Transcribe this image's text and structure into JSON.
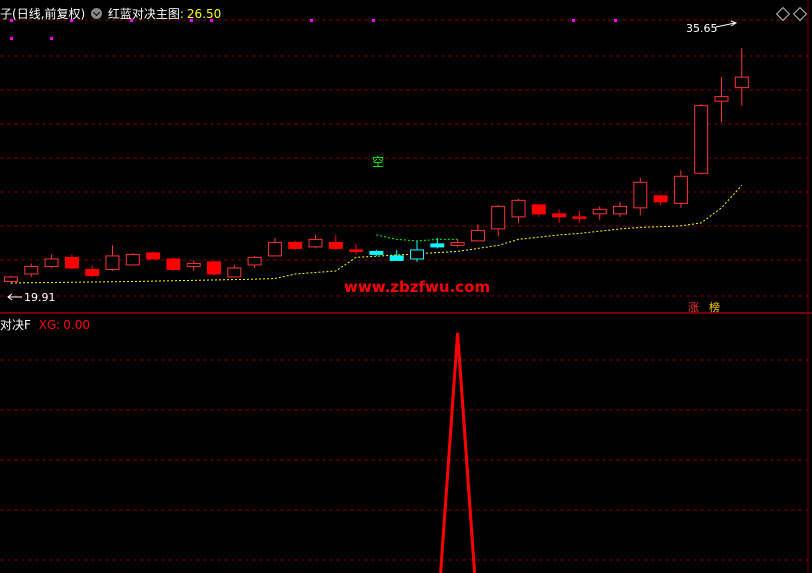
{
  "header": {
    "stock_name": "子",
    "period_label": "(日线,前复权)",
    "indicator_name": "红蓝对决主图",
    "indicator_sep": ":",
    "indicator_value": "26.50"
  },
  "sub_panel": {
    "indicator_name": "对决F",
    "series_label": "XG:",
    "series_value": "0.00"
  },
  "labels": {
    "high_price": "35.65",
    "low_price": "19.91",
    "kong_marker": "空",
    "watermark": "www.zbzfwu.com",
    "badge_zhang": "涨",
    "badge_bang": "榜"
  },
  "colors": {
    "up": "#ff3232",
    "down": "#ff0000",
    "cyan": "#00ffff",
    "line_yellow": "#ffff00",
    "line_green": "#00ff00",
    "grid": "#7a0000",
    "text_white": "#ffffff",
    "text_yellow": "#ffff00",
    "text_red": "#ff0000",
    "text_magenta": "#ff00ff"
  },
  "chart_data": [
    {
      "type": "candlestick",
      "title": "红蓝对决主图",
      "ylim": [
        19.0,
        37.5
      ],
      "y_high_label": 35.65,
      "y_low_label": 19.91,
      "candles": [
        {
          "o": 20.1,
          "h": 20.5,
          "l": 19.91,
          "c": 20.4,
          "k": "up"
        },
        {
          "o": 20.6,
          "h": 21.3,
          "l": 20.4,
          "c": 21.1,
          "k": "up"
        },
        {
          "o": 21.1,
          "h": 21.9,
          "l": 21.0,
          "c": 21.6,
          "k": "up"
        },
        {
          "o": 21.7,
          "h": 21.9,
          "l": 20.9,
          "c": 21.0,
          "k": "down"
        },
        {
          "o": 20.9,
          "h": 21.2,
          "l": 20.4,
          "c": 20.5,
          "k": "down"
        },
        {
          "o": 20.9,
          "h": 22.5,
          "l": 20.8,
          "c": 21.8,
          "k": "up"
        },
        {
          "o": 21.2,
          "h": 22.0,
          "l": 21.2,
          "c": 21.9,
          "k": "up"
        },
        {
          "o": 22.0,
          "h": 22.1,
          "l": 21.6,
          "c": 21.6,
          "k": "down"
        },
        {
          "o": 21.6,
          "h": 21.7,
          "l": 20.8,
          "c": 20.9,
          "k": "down"
        },
        {
          "o": 21.1,
          "h": 21.5,
          "l": 20.8,
          "c": 21.3,
          "k": "up"
        },
        {
          "o": 21.4,
          "h": 21.5,
          "l": 20.5,
          "c": 20.6,
          "k": "down"
        },
        {
          "o": 20.4,
          "h": 21.2,
          "l": 20.4,
          "c": 21.0,
          "k": "up"
        },
        {
          "o": 21.2,
          "h": 21.8,
          "l": 21.0,
          "c": 21.7,
          "k": "up"
        },
        {
          "o": 21.8,
          "h": 23.0,
          "l": 21.8,
          "c": 22.7,
          "k": "up"
        },
        {
          "o": 22.7,
          "h": 22.8,
          "l": 22.2,
          "c": 22.3,
          "k": "down"
        },
        {
          "o": 22.4,
          "h": 23.2,
          "l": 22.3,
          "c": 22.9,
          "k": "up"
        },
        {
          "o": 22.7,
          "h": 23.2,
          "l": 22.2,
          "c": 22.3,
          "k": "down"
        },
        {
          "o": 22.2,
          "h": 22.6,
          "l": 21.9,
          "c": 22.2,
          "k": "down"
        },
        {
          "o": 21.9,
          "h": 22.2,
          "l": 21.8,
          "c": 22.1,
          "k": "cyan"
        },
        {
          "o": 21.5,
          "h": 22.2,
          "l": 21.5,
          "c": 21.8,
          "k": "cyan"
        },
        {
          "o": 21.6,
          "h": 22.8,
          "l": 21.4,
          "c": 22.2,
          "k": "cyanup"
        },
        {
          "o": 22.4,
          "h": 23.0,
          "l": 22.3,
          "c": 22.6,
          "k": "cyan"
        },
        {
          "o": 22.5,
          "h": 22.9,
          "l": 22.4,
          "c": 22.7,
          "k": "up"
        },
        {
          "o": 22.8,
          "h": 23.9,
          "l": 22.8,
          "c": 23.5,
          "k": "up"
        },
        {
          "o": 23.6,
          "h": 25.2,
          "l": 23.1,
          "c": 25.1,
          "k": "up"
        },
        {
          "o": 24.4,
          "h": 25.6,
          "l": 24.0,
          "c": 25.5,
          "k": "up"
        },
        {
          "o": 25.2,
          "h": 25.2,
          "l": 24.4,
          "c": 24.6,
          "k": "down"
        },
        {
          "o": 24.6,
          "h": 24.9,
          "l": 24.0,
          "c": 24.4,
          "k": "down"
        },
        {
          "o": 24.4,
          "h": 24.8,
          "l": 24.0,
          "c": 24.4,
          "k": "down"
        },
        {
          "o": 24.6,
          "h": 25.1,
          "l": 24.2,
          "c": 24.9,
          "k": "up"
        },
        {
          "o": 24.6,
          "h": 25.4,
          "l": 24.4,
          "c": 25.1,
          "k": "up"
        },
        {
          "o": 25.0,
          "h": 27.0,
          "l": 24.5,
          "c": 26.7,
          "k": "up"
        },
        {
          "o": 25.8,
          "h": 25.9,
          "l": 25.2,
          "c": 25.4,
          "k": "down"
        },
        {
          "o": 25.3,
          "h": 27.5,
          "l": 25.0,
          "c": 27.1,
          "k": "up"
        },
        {
          "o": 27.3,
          "h": 31.9,
          "l": 27.2,
          "c": 31.8,
          "k": "up"
        },
        {
          "o": 32.1,
          "h": 33.7,
          "l": 30.7,
          "c": 32.4,
          "k": "up"
        },
        {
          "o": 33.0,
          "h": 35.65,
          "l": 31.8,
          "c": 33.7,
          "k": "up"
        }
      ],
      "support_line": [
        {
          "i": 0,
          "v": 20.0
        },
        {
          "i": 6,
          "v": 20.1
        },
        {
          "i": 12,
          "v": 20.25
        },
        {
          "i": 13,
          "v": 20.3
        },
        {
          "i": 14,
          "v": 20.6
        },
        {
          "i": 16,
          "v": 20.8
        },
        {
          "i": 17,
          "v": 21.7
        },
        {
          "i": 22,
          "v": 22.1
        },
        {
          "i": 24,
          "v": 22.5
        },
        {
          "i": 25,
          "v": 22.9
        },
        {
          "i": 27,
          "v": 23.2
        },
        {
          "i": 28,
          "v": 23.3
        },
        {
          "i": 30,
          "v": 23.6
        },
        {
          "i": 31,
          "v": 23.7
        },
        {
          "i": 33,
          "v": 23.8
        },
        {
          "i": 34,
          "v": 24.0
        },
        {
          "i": 35,
          "v": 25.0
        },
        {
          "i": 36,
          "v": 26.5
        }
      ],
      "green_line": [
        {
          "i": 18,
          "v": 23.2
        },
        {
          "i": 19,
          "v": 22.9
        },
        {
          "i": 20,
          "v": 22.8
        },
        {
          "i": 21,
          "v": 22.9
        },
        {
          "i": 22,
          "v": 22.9
        }
      ]
    },
    {
      "type": "line",
      "title": "对决F",
      "series": [
        {
          "name": "XG",
          "values": [
            0,
            1,
            0
          ]
        }
      ],
      "spike_at_candle": 22
    }
  ]
}
